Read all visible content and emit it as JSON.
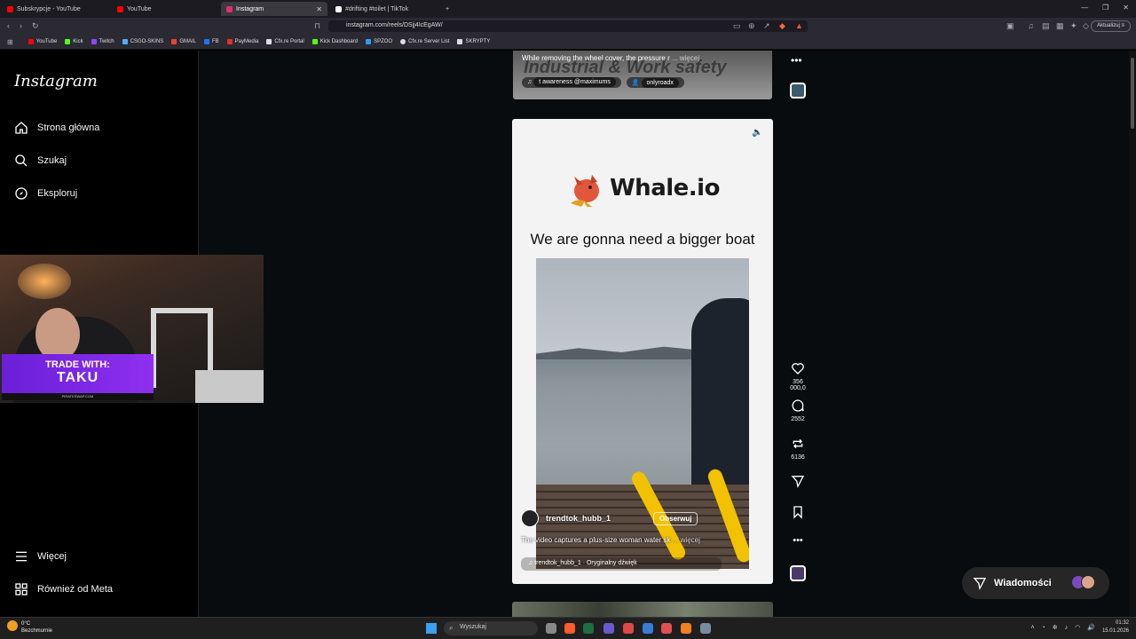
{
  "browser": {
    "tabs": [
      {
        "label": "Subskrypcje - YouTube",
        "color": "#ff0000"
      },
      {
        "label": "YouTube",
        "color": "#ff0000"
      },
      {
        "label": "Instagram",
        "color": "#e1306c",
        "active": true
      },
      {
        "label": "#drifting #toilet | TikTok",
        "color": "#ffffff"
      }
    ],
    "url": "instagram.com/reels/DSjj4IcEgAW/",
    "update_label": "Aktualizuj",
    "bookmarks": [
      {
        "label": "YouTube",
        "color": "#ff0000"
      },
      {
        "label": "Kick",
        "color": "#53fc18"
      },
      {
        "label": "Twitch",
        "color": "#9146ff"
      },
      {
        "label": "CSGO-SKINS",
        "color": "#4ab0ff"
      },
      {
        "label": "GMAIL",
        "color": "#ea4335"
      },
      {
        "label": "FB",
        "color": "#1877f2"
      },
      {
        "label": "PayMedia",
        "color": "#e03030"
      },
      {
        "label": "Cfx.re Portal",
        "color": "#dddddd"
      },
      {
        "label": "Kick Dashboard",
        "color": "#53fc18"
      },
      {
        "label": "SPZOO",
        "color": "#2a9df4"
      },
      {
        "label": "Cfx.re Server List",
        "color": "#dddddd"
      },
      {
        "label": "SKRYPTY",
        "color": "#dddddd"
      }
    ]
  },
  "sidebar": {
    "logo": "Instagram",
    "items": [
      {
        "label": "Strona główna",
        "icon": "home-icon"
      },
      {
        "label": "Szukaj",
        "icon": "search-icon"
      },
      {
        "label": "Eksploruj",
        "icon": "explore-icon"
      }
    ],
    "bottom": [
      {
        "label": "Więcej",
        "icon": "menu-icon"
      },
      {
        "label": "Również od Meta",
        "icon": "meta-icon"
      }
    ]
  },
  "overlay": {
    "banner_line1": "TRADE WITH:",
    "banner_line2": "TAKU",
    "banner_line3": "PIRATESWAP.COM"
  },
  "reel_top": {
    "caption": "While removing the wheel cover, the pressure r",
    "more": "... więcej",
    "big_text": "Industrial & Work safety",
    "audio": "t awareness @maximums",
    "tagged": "onlyroadx"
  },
  "reel": {
    "brand": "Whale.io",
    "headline": "We are gonna need a bigger boat",
    "username": "trendtok_hubb_1",
    "follow": "Obserwuj",
    "caption": "The video captures a plus-size woman water sk",
    "more": "... więcej",
    "audio": "trendtok_hubb_1 · Oryginalny dźwięk"
  },
  "actions": {
    "likes": "356 000,0",
    "comments": "2552",
    "reposts": "6136"
  },
  "messages": {
    "label": "Wiadomości"
  },
  "taskbar": {
    "temp": "0°C",
    "weather": "Bezchmurnie",
    "search": "Wyszukaj",
    "time": "01:32",
    "date": "15.01.2026"
  }
}
